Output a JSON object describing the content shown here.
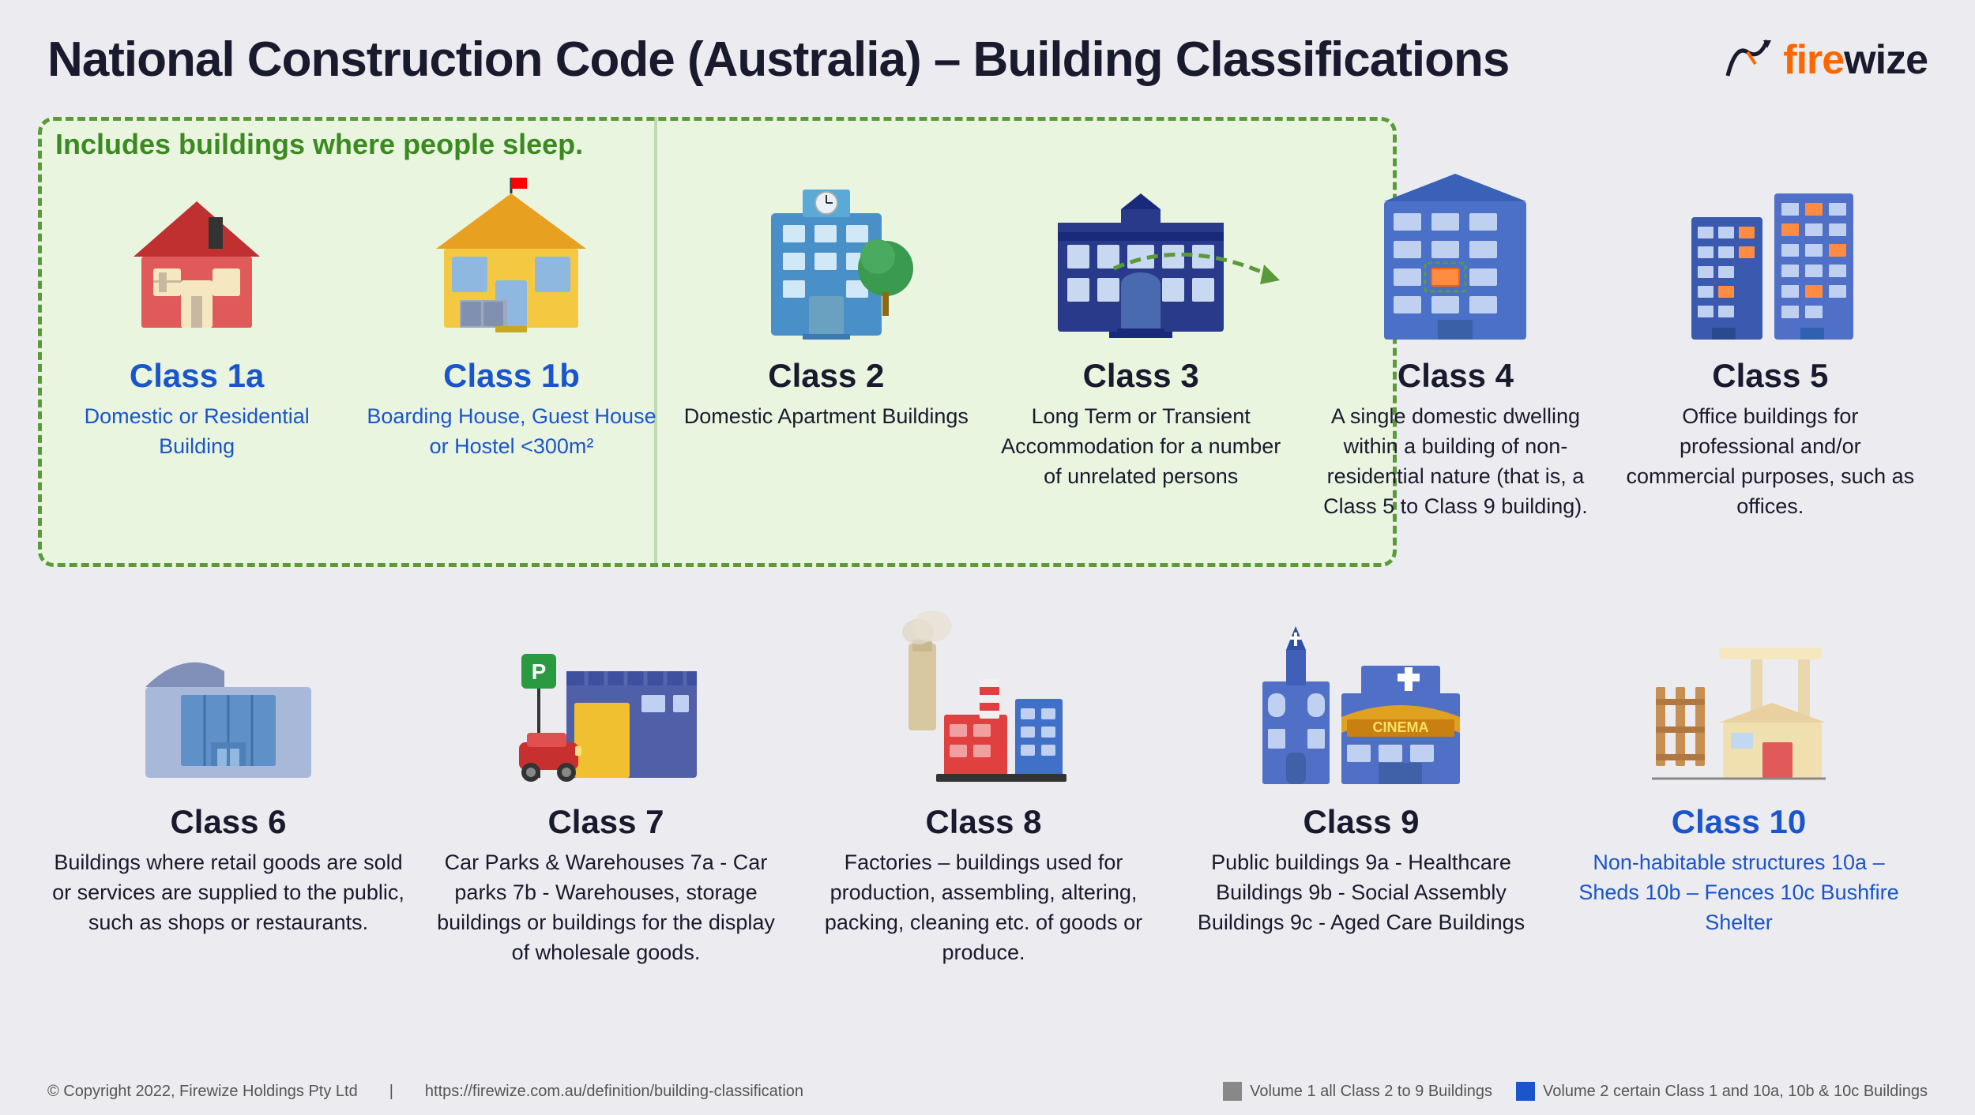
{
  "header": {
    "title": "National Construction Code (Australia) – Building Classifications",
    "logo_text": "firewize"
  },
  "greenBox": {
    "label": "Includes buildings where people sleep."
  },
  "classes": [
    {
      "name": "Class 1a",
      "desc": "Domestic or\nResidential\nBuilding"
    },
    {
      "name": "Class 1b",
      "desc": "Boarding House,\nGuest House or\nHostel <300m²"
    },
    {
      "name": "Class 2",
      "desc": "Domestic\nApartment\nBuildings"
    },
    {
      "name": "Class 3",
      "desc": "Long Term or Transient\nAccommodation for a\nnumber of unrelated\npersons"
    },
    {
      "name": "Class 4",
      "desc": "A single domestic dwelling\nwithin a building of\nnon-residential nature (that is,\na Class 5 to Class 9 building)."
    },
    {
      "name": "Class 5",
      "desc": "Office buildings for\nprofessional and/or\ncommercial purposes,\nsuch as offices."
    },
    {
      "name": "Class 6",
      "desc": "Buildings where retail\ngoods are sold or services\nare supplied to the public,\nsuch as shops or\nrestaurants."
    },
    {
      "name": "Class 7",
      "desc": "Car Parks & Warehouses\n7a - Car parks\n7b - Warehouses, storage\nbuildings or buildings for the\ndisplay of wholesale goods."
    },
    {
      "name": "Class 8",
      "desc": "Factories – buildings used\nfor production,\nassembling, altering,\npacking, cleaning etc. of\ngoods or produce."
    },
    {
      "name": "Class 9",
      "desc": "Public buildings\n9a - Healthcare Buildings\n9b - Social Assembly Buildings\n9c - Aged Care Buildings"
    },
    {
      "name": "Class 10",
      "desc": "Non-habitable\nstructures\n10a – Sheds\n10b – Fences\n10c Bushfire Shelter"
    }
  ],
  "footer": {
    "copyright": "© Copyright 2022, Firewize Holdings Pty Ltd",
    "url": "https://firewize.com.au/definition/building-classification",
    "legend": [
      {
        "text": "Volume 1 all Class 2 to 9 Buildings"
      },
      {
        "text": "Volume 2 certain Class 1 and 10a, 10b & 10c Buildings"
      }
    ]
  }
}
